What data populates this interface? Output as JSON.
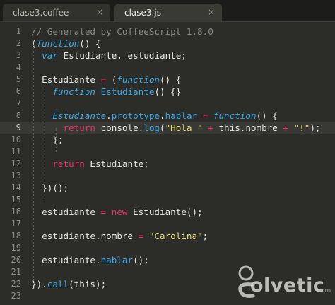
{
  "tabs": [
    {
      "label": "clase3.coffee",
      "close": "×"
    },
    {
      "label": "clase3.js",
      "close": "×"
    }
  ],
  "editor": {
    "current_line": 9,
    "line_numbers": [
      "1",
      "2",
      "3",
      "4",
      "5",
      "6",
      "7",
      "8",
      "9",
      "10",
      "11",
      "12",
      "13",
      "14",
      "15",
      "16",
      "17",
      "18",
      "19",
      "20",
      "21",
      "22",
      "23"
    ],
    "lines": [
      [
        [
          "c",
          "// Generated by CoffeeScript 1.8.0"
        ]
      ],
      [
        [
          "pl",
          "("
        ],
        [
          "kw",
          "function"
        ],
        [
          "pl",
          "() {"
        ]
      ],
      [
        [
          "pl",
          "  "
        ],
        [
          "kw",
          "var"
        ],
        [
          "pl",
          " Estudiante, estudiante;"
        ]
      ],
      [],
      [
        [
          "pl",
          "  Estudiante "
        ],
        [
          "op",
          "="
        ],
        [
          "pl",
          " ("
        ],
        [
          "kw",
          "function"
        ],
        [
          "pl",
          "() {"
        ]
      ],
      [
        [
          "pl",
          "    "
        ],
        [
          "kw",
          "function"
        ],
        [
          "pl",
          " "
        ],
        [
          "fn",
          "Estudiante"
        ],
        [
          "pl",
          "() {}"
        ]
      ],
      [],
      [
        [
          "pl",
          "    "
        ],
        [
          "cls",
          "Estudiante"
        ],
        [
          "pl",
          "."
        ],
        [
          "fn",
          "prototype"
        ],
        [
          "pl",
          "."
        ],
        [
          "fn",
          "hablar"
        ],
        [
          "pl",
          " "
        ],
        [
          "op",
          "="
        ],
        [
          "pl",
          " "
        ],
        [
          "kw",
          "function"
        ],
        [
          "pl",
          "() {"
        ]
      ],
      [
        [
          "pl",
          "      "
        ],
        [
          "retkw",
          "return"
        ],
        [
          "pl",
          " console."
        ],
        [
          "fn",
          "log"
        ],
        [
          "pl",
          "("
        ],
        [
          "st",
          "\"Hola \""
        ],
        [
          "pl",
          " "
        ],
        [
          "op",
          "+"
        ],
        [
          "pl",
          " this.nombre "
        ],
        [
          "op",
          "+"
        ],
        [
          "pl",
          " "
        ],
        [
          "st",
          "\"!\""
        ],
        [
          "pl",
          ");"
        ]
      ],
      [
        [
          "pl",
          "    };"
        ]
      ],
      [],
      [
        [
          "pl",
          "    "
        ],
        [
          "retkw",
          "return"
        ],
        [
          "pl",
          " Estudiante;"
        ]
      ],
      [],
      [
        [
          "pl",
          "  })();"
        ]
      ],
      [],
      [
        [
          "pl",
          "  estudiante "
        ],
        [
          "op",
          "="
        ],
        [
          "pl",
          " "
        ],
        [
          "retkw",
          "new"
        ],
        [
          "pl",
          " Estudiante();"
        ]
      ],
      [],
      [
        [
          "pl",
          "  estudiante.nombre "
        ],
        [
          "op",
          "="
        ],
        [
          "pl",
          " "
        ],
        [
          "st",
          "\"Carolina\""
        ],
        [
          "pl",
          ";"
        ]
      ],
      [],
      [
        [
          "pl",
          "  estudiante."
        ],
        [
          "fn",
          "hablar"
        ],
        [
          "pl",
          "();"
        ]
      ],
      [],
      [
        [
          "pl",
          "})."
        ],
        [
          "fn",
          "call"
        ],
        [
          "pl",
          "(this);"
        ]
      ],
      []
    ]
  },
  "watermark": {
    "brand": "olvetic",
    "domain": ".com"
  }
}
